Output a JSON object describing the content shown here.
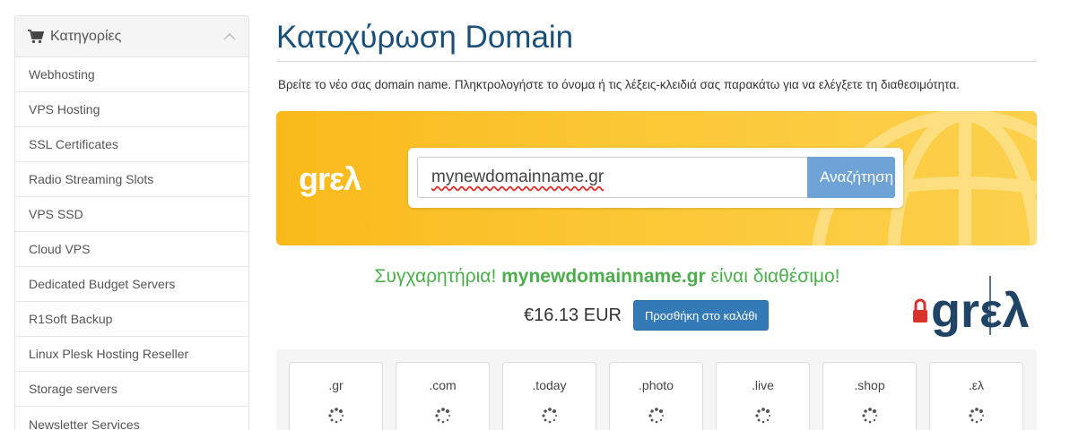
{
  "sidebar": {
    "title": "Κατηγορίες",
    "items": [
      {
        "label": "Webhosting"
      },
      {
        "label": "VPS Hosting"
      },
      {
        "label": "SSL Certificates"
      },
      {
        "label": "Radio Streaming Slots"
      },
      {
        "label": "VPS SSD"
      },
      {
        "label": "Cloud VPS"
      },
      {
        "label": "Dedicated Budget Servers"
      },
      {
        "label": "R1Soft Backup"
      },
      {
        "label": "Linux Plesk Hosting Reseller"
      },
      {
        "label": "Storage servers"
      },
      {
        "label": "Newsletter Services"
      }
    ]
  },
  "main": {
    "title": "Κατοχύρωση Domain",
    "intro": "Βρείτε το νέο σας domain name. Πληκτρολογήστε το όνομα ή τις λέξεις-κλειδιά σας παρακάτω για να ελέγξετε τη διαθεσιμότητα.",
    "banner_logo": "grελ",
    "search": {
      "value": "mynewdomainname.gr",
      "button_label": "Αναζήτηση"
    },
    "result": {
      "prefix": "Συγχαρητήρια! ",
      "domain": "mynewdomainname.gr",
      "suffix": " είναι διαθέσιμο!",
      "price": "€16.13 EUR",
      "add_to_cart": "Προσθήκη στο καλάθι"
    },
    "registry_logo": "grελ",
    "tlds": [
      ".gr",
      ".com",
      ".today",
      ".photo",
      ".live",
      ".shop",
      ".ελ"
    ]
  },
  "colors": {
    "title": "#1a4f7a",
    "success": "#4cae4c",
    "primary_button": "#337ab7",
    "search_button": "#6fa3d6",
    "banner": "#fbc632"
  }
}
